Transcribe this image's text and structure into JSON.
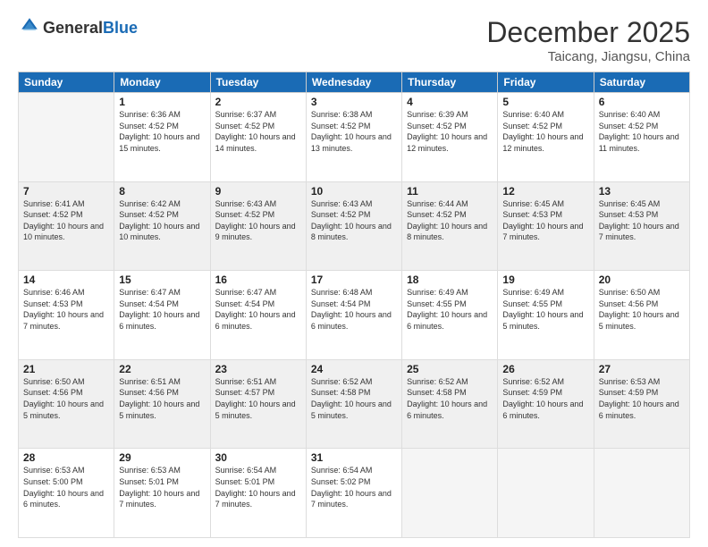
{
  "logo": {
    "general": "General",
    "blue": "Blue"
  },
  "header": {
    "month": "December 2025",
    "location": "Taicang, Jiangsu, China"
  },
  "weekdays": [
    "Sunday",
    "Monday",
    "Tuesday",
    "Wednesday",
    "Thursday",
    "Friday",
    "Saturday"
  ],
  "weeks": [
    [
      {
        "day": "",
        "empty": true
      },
      {
        "day": "1",
        "sunrise": "Sunrise: 6:36 AM",
        "sunset": "Sunset: 4:52 PM",
        "daylight": "Daylight: 10 hours and 15 minutes."
      },
      {
        "day": "2",
        "sunrise": "Sunrise: 6:37 AM",
        "sunset": "Sunset: 4:52 PM",
        "daylight": "Daylight: 10 hours and 14 minutes."
      },
      {
        "day": "3",
        "sunrise": "Sunrise: 6:38 AM",
        "sunset": "Sunset: 4:52 PM",
        "daylight": "Daylight: 10 hours and 13 minutes."
      },
      {
        "day": "4",
        "sunrise": "Sunrise: 6:39 AM",
        "sunset": "Sunset: 4:52 PM",
        "daylight": "Daylight: 10 hours and 12 minutes."
      },
      {
        "day": "5",
        "sunrise": "Sunrise: 6:40 AM",
        "sunset": "Sunset: 4:52 PM",
        "daylight": "Daylight: 10 hours and 12 minutes."
      },
      {
        "day": "6",
        "sunrise": "Sunrise: 6:40 AM",
        "sunset": "Sunset: 4:52 PM",
        "daylight": "Daylight: 10 hours and 11 minutes."
      }
    ],
    [
      {
        "day": "7",
        "sunrise": "Sunrise: 6:41 AM",
        "sunset": "Sunset: 4:52 PM",
        "daylight": "Daylight: 10 hours and 10 minutes."
      },
      {
        "day": "8",
        "sunrise": "Sunrise: 6:42 AM",
        "sunset": "Sunset: 4:52 PM",
        "daylight": "Daylight: 10 hours and 10 minutes."
      },
      {
        "day": "9",
        "sunrise": "Sunrise: 6:43 AM",
        "sunset": "Sunset: 4:52 PM",
        "daylight": "Daylight: 10 hours and 9 minutes."
      },
      {
        "day": "10",
        "sunrise": "Sunrise: 6:43 AM",
        "sunset": "Sunset: 4:52 PM",
        "daylight": "Daylight: 10 hours and 8 minutes."
      },
      {
        "day": "11",
        "sunrise": "Sunrise: 6:44 AM",
        "sunset": "Sunset: 4:52 PM",
        "daylight": "Daylight: 10 hours and 8 minutes."
      },
      {
        "day": "12",
        "sunrise": "Sunrise: 6:45 AM",
        "sunset": "Sunset: 4:53 PM",
        "daylight": "Daylight: 10 hours and 7 minutes."
      },
      {
        "day": "13",
        "sunrise": "Sunrise: 6:45 AM",
        "sunset": "Sunset: 4:53 PM",
        "daylight": "Daylight: 10 hours and 7 minutes."
      }
    ],
    [
      {
        "day": "14",
        "sunrise": "Sunrise: 6:46 AM",
        "sunset": "Sunset: 4:53 PM",
        "daylight": "Daylight: 10 hours and 7 minutes."
      },
      {
        "day": "15",
        "sunrise": "Sunrise: 6:47 AM",
        "sunset": "Sunset: 4:54 PM",
        "daylight": "Daylight: 10 hours and 6 minutes."
      },
      {
        "day": "16",
        "sunrise": "Sunrise: 6:47 AM",
        "sunset": "Sunset: 4:54 PM",
        "daylight": "Daylight: 10 hours and 6 minutes."
      },
      {
        "day": "17",
        "sunrise": "Sunrise: 6:48 AM",
        "sunset": "Sunset: 4:54 PM",
        "daylight": "Daylight: 10 hours and 6 minutes."
      },
      {
        "day": "18",
        "sunrise": "Sunrise: 6:49 AM",
        "sunset": "Sunset: 4:55 PM",
        "daylight": "Daylight: 10 hours and 6 minutes."
      },
      {
        "day": "19",
        "sunrise": "Sunrise: 6:49 AM",
        "sunset": "Sunset: 4:55 PM",
        "daylight": "Daylight: 10 hours and 5 minutes."
      },
      {
        "day": "20",
        "sunrise": "Sunrise: 6:50 AM",
        "sunset": "Sunset: 4:56 PM",
        "daylight": "Daylight: 10 hours and 5 minutes."
      }
    ],
    [
      {
        "day": "21",
        "sunrise": "Sunrise: 6:50 AM",
        "sunset": "Sunset: 4:56 PM",
        "daylight": "Daylight: 10 hours and 5 minutes."
      },
      {
        "day": "22",
        "sunrise": "Sunrise: 6:51 AM",
        "sunset": "Sunset: 4:56 PM",
        "daylight": "Daylight: 10 hours and 5 minutes."
      },
      {
        "day": "23",
        "sunrise": "Sunrise: 6:51 AM",
        "sunset": "Sunset: 4:57 PM",
        "daylight": "Daylight: 10 hours and 5 minutes."
      },
      {
        "day": "24",
        "sunrise": "Sunrise: 6:52 AM",
        "sunset": "Sunset: 4:58 PM",
        "daylight": "Daylight: 10 hours and 5 minutes."
      },
      {
        "day": "25",
        "sunrise": "Sunrise: 6:52 AM",
        "sunset": "Sunset: 4:58 PM",
        "daylight": "Daylight: 10 hours and 6 minutes."
      },
      {
        "day": "26",
        "sunrise": "Sunrise: 6:52 AM",
        "sunset": "Sunset: 4:59 PM",
        "daylight": "Daylight: 10 hours and 6 minutes."
      },
      {
        "day": "27",
        "sunrise": "Sunrise: 6:53 AM",
        "sunset": "Sunset: 4:59 PM",
        "daylight": "Daylight: 10 hours and 6 minutes."
      }
    ],
    [
      {
        "day": "28",
        "sunrise": "Sunrise: 6:53 AM",
        "sunset": "Sunset: 5:00 PM",
        "daylight": "Daylight: 10 hours and 6 minutes."
      },
      {
        "day": "29",
        "sunrise": "Sunrise: 6:53 AM",
        "sunset": "Sunset: 5:01 PM",
        "daylight": "Daylight: 10 hours and 7 minutes."
      },
      {
        "day": "30",
        "sunrise": "Sunrise: 6:54 AM",
        "sunset": "Sunset: 5:01 PM",
        "daylight": "Daylight: 10 hours and 7 minutes."
      },
      {
        "day": "31",
        "sunrise": "Sunrise: 6:54 AM",
        "sunset": "Sunset: 5:02 PM",
        "daylight": "Daylight: 10 hours and 7 minutes."
      },
      {
        "day": "",
        "empty": true
      },
      {
        "day": "",
        "empty": true
      },
      {
        "day": "",
        "empty": true
      }
    ]
  ]
}
